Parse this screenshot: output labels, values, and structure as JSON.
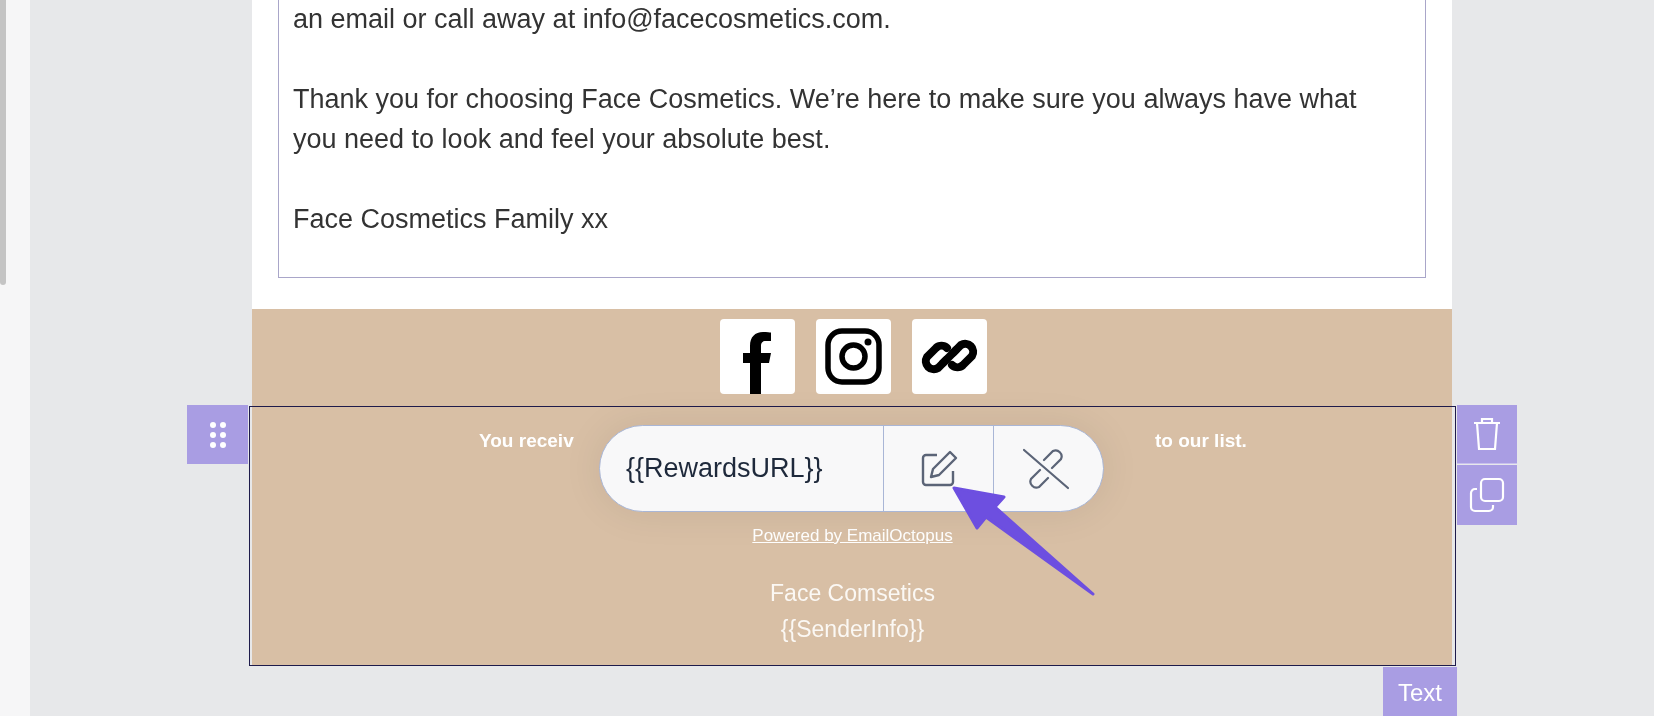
{
  "text_block": {
    "paragraphs": [
      "an email or call away at info@facecosmetics.com.",
      "Thank you for choosing Face Cosmetics. We’re here to make sure you always have what you need to look and feel your absolute best.",
      "Face Cosmetics Family xx"
    ]
  },
  "social_icons": [
    {
      "kind": "facebook"
    },
    {
      "kind": "instagram"
    },
    {
      "kind": "link"
    }
  ],
  "footer_block": {
    "selected": true,
    "text_fragments": [
      "You receiv",
      "to our list."
    ],
    "powered_by": "Powered by EmailOctopus",
    "sender_lines": [
      "Face Comsetics",
      "{{SenderInfo}}"
    ],
    "block_type_label": "Text"
  },
  "link_popup": {
    "url": "{{RewardsURL}}"
  }
}
